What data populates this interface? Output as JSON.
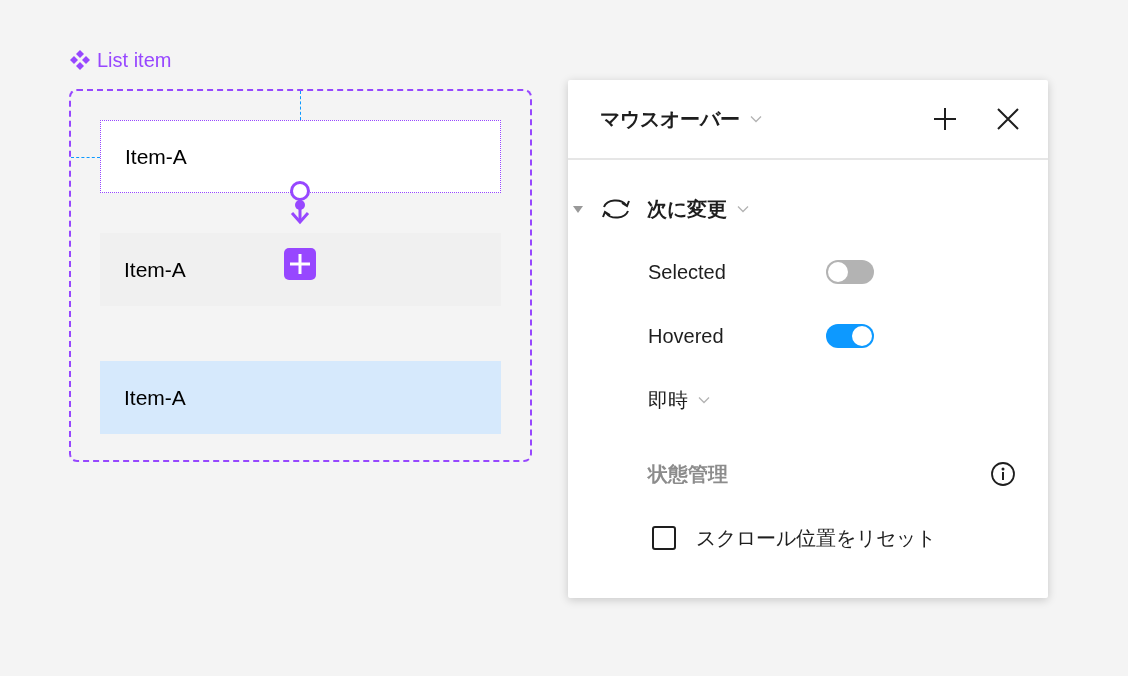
{
  "component": {
    "label": "List item"
  },
  "items": [
    {
      "label": "Item-A",
      "kind": "selected"
    },
    {
      "label": "Item-A",
      "kind": "hover"
    },
    {
      "label": "Item-A",
      "kind": "pressed"
    }
  ],
  "panel": {
    "trigger": "マウスオーバー",
    "action": {
      "label": "次に変更",
      "expanded": true
    },
    "properties": [
      {
        "name": "Selected",
        "on": false
      },
      {
        "name": "Hovered",
        "on": true
      }
    ],
    "animation": "即時",
    "section": "状態管理",
    "reset_scroll": {
      "label": "スクロール位置をリセット",
      "checked": false
    }
  }
}
